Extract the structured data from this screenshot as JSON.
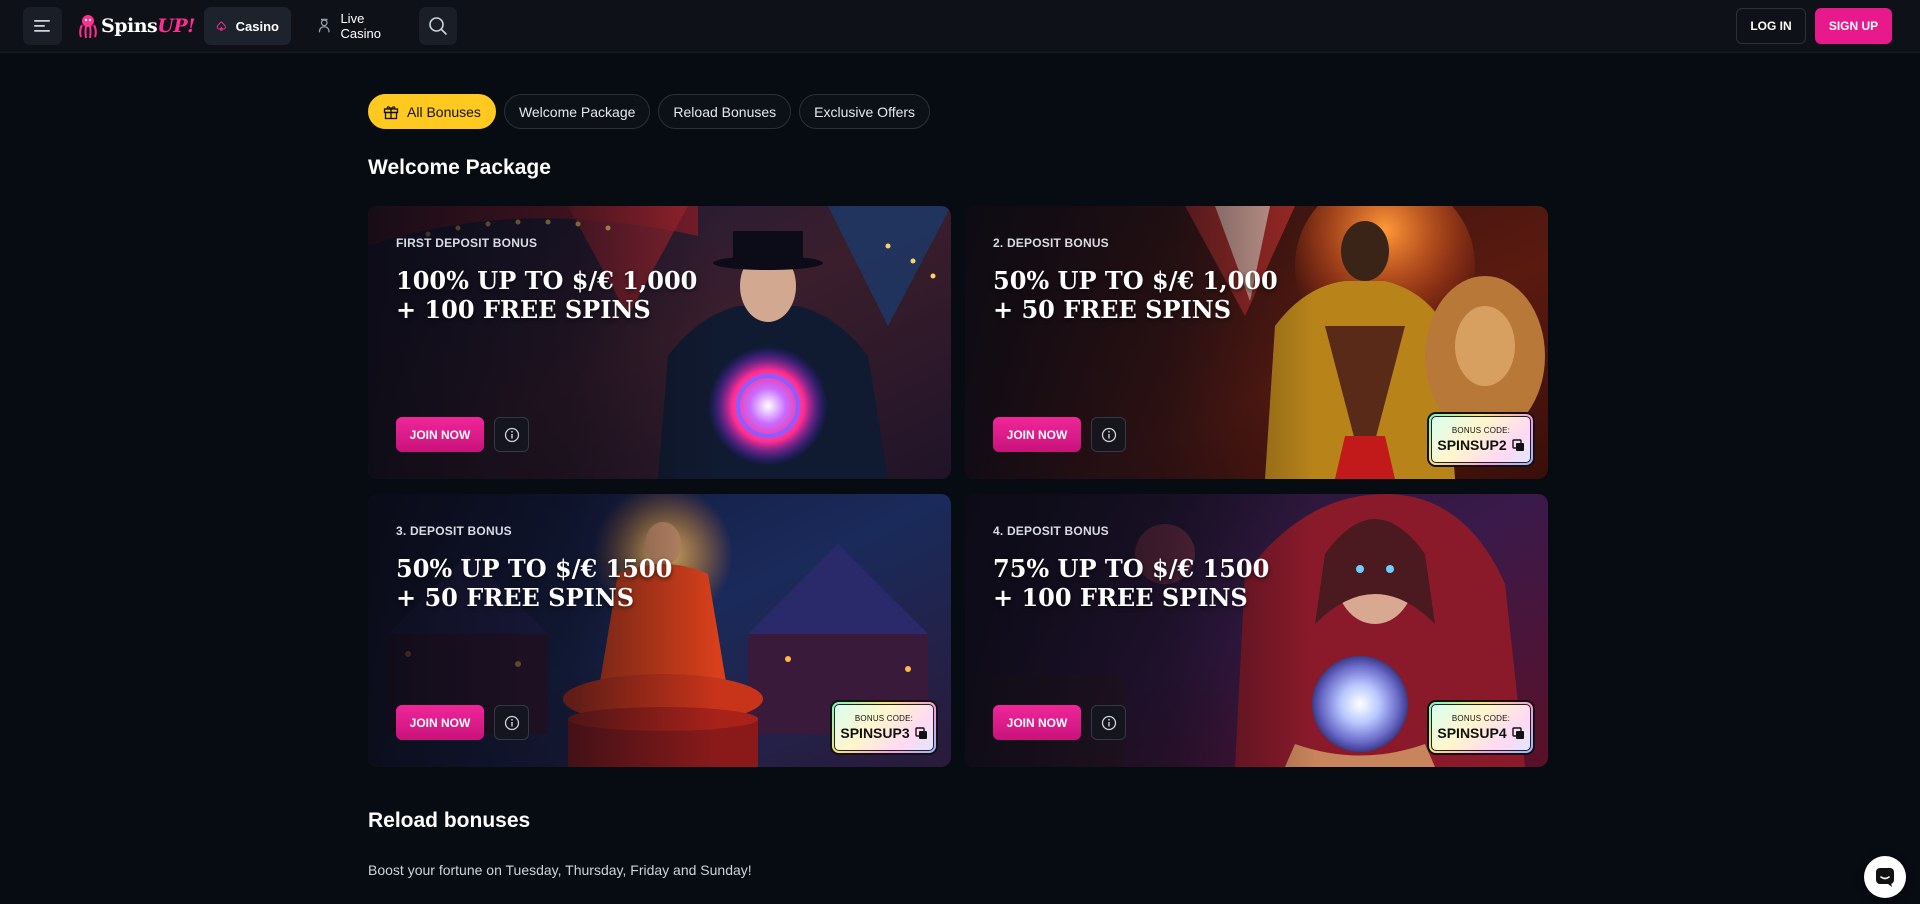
{
  "header": {
    "logo": {
      "main": "Spins",
      "accent": "UP!"
    },
    "nav": [
      {
        "label": "Casino",
        "active": true
      },
      {
        "label": "Live Casino",
        "active": false
      }
    ],
    "login_label": "LOG IN",
    "signup_label": "SIGN UP"
  },
  "filters": [
    {
      "label": "All Bonuses",
      "active": true
    },
    {
      "label": "Welcome Package",
      "active": false
    },
    {
      "label": "Reload Bonuses",
      "active": false
    },
    {
      "label": "Exclusive Offers",
      "active": false
    }
  ],
  "welcome": {
    "title": "Welcome Package",
    "cards": [
      {
        "label": "FIRST DEPOSIT BONUS",
        "line1": "100% UP TO $/€ 1,000",
        "line2": "+ 100 FREE SPINS",
        "join_label": "JOIN NOW",
        "code_label": "",
        "code": ""
      },
      {
        "label": "2. DEPOSIT BONUS",
        "line1": "50% UP TO $/€ 1,000",
        "line2": "+ 50 FREE SPINS",
        "join_label": "JOIN NOW",
        "code_label": "BONUS CODE:",
        "code": "SPINSUP2"
      },
      {
        "label": "3. DEPOSIT BONUS",
        "line1": "50% UP TO $/€ 1500",
        "line2": "+ 50 FREE SPINS",
        "join_label": "JOIN NOW",
        "code_label": "BONUS CODE:",
        "code": "SPINSUP3"
      },
      {
        "label": "4. DEPOSIT BONUS",
        "line1": "75% UP TO $/€ 1500",
        "line2": "+ 100 FREE SPINS",
        "join_label": "JOIN NOW",
        "code_label": "BONUS CODE:",
        "code": "SPINSUP4"
      }
    ]
  },
  "reload": {
    "title": "Reload bonuses",
    "description": "Boost your fortune on Tuesday, Thursday, Friday and Sunday!"
  },
  "colors": {
    "accent_pink": "#e8198b",
    "accent_yellow": "#ffc91f",
    "background": "#070b12"
  }
}
